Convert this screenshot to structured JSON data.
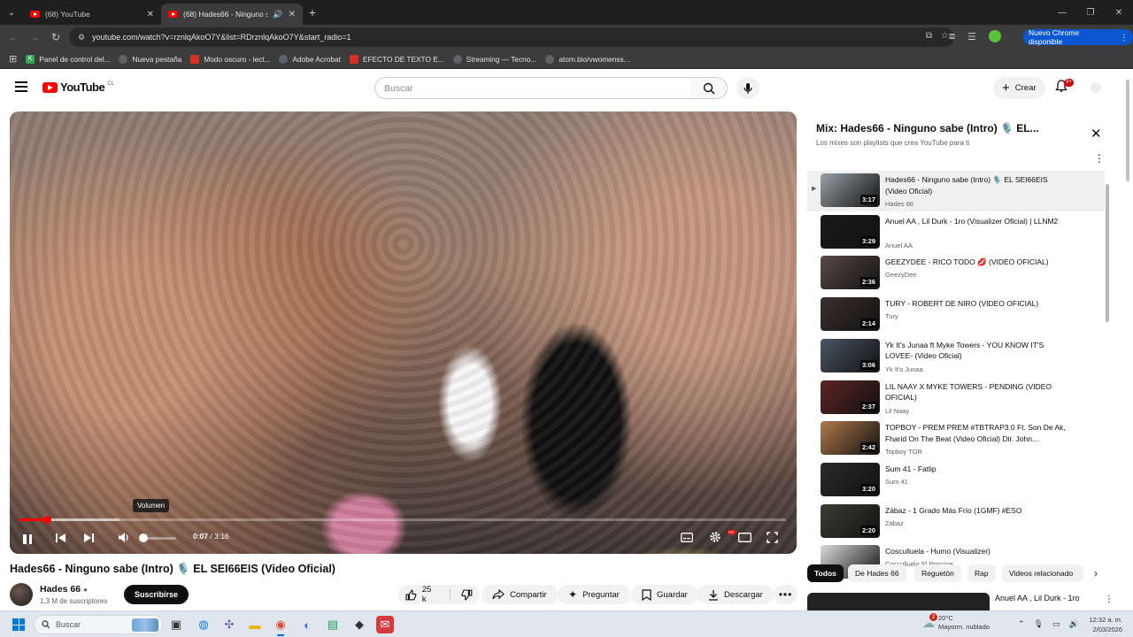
{
  "browser": {
    "tabs": [
      {
        "title": "(68) YouTube"
      },
      {
        "title": "(68) Hades66 - Ninguno sabe"
      }
    ],
    "url": "youtube.com/watch?v=rznlqAkoO7Y&list=RDrznlqAkoO7Y&start_radio=1",
    "update_button": "Nuevo Chrome disponible",
    "bookmarks": [
      {
        "label": "Panel de control del...",
        "color": "#34a853"
      },
      {
        "label": "Nueva pestaña",
        "color": "#5f6368"
      },
      {
        "label": "Modo oscuro - lect...",
        "color": "#d93025"
      },
      {
        "label": "Adobe Acrobat",
        "color": "#5f6368"
      },
      {
        "label": "EFECTO DE TEXTO E...",
        "color": "#d93025"
      },
      {
        "label": "Streaming — Tecno...",
        "color": "#5f6368"
      },
      {
        "label": "atom.bio/vwomenss...",
        "color": "#5f6368"
      }
    ]
  },
  "youtube": {
    "logo_text": "YouTube",
    "country": "CL",
    "search_placeholder": "Buscar",
    "create_label": "Crear",
    "notifications_badge": "9+"
  },
  "player": {
    "volume_tooltip": "Volumen",
    "time_current": "0:07",
    "time_total": "3:16",
    "progress_fraction": 0.036,
    "buffered_fraction": 0.13,
    "volume_fraction": 0.2
  },
  "video": {
    "title": "Hades66 - Ninguno sabe (Intro) 🎙️ EL SEI66EIS (Video Oficial)",
    "channel": "Hades 66",
    "subscribers": "1,3 M de suscriptores",
    "subscribe_label": "Suscribirse",
    "likes": "25 k",
    "share_label": "Compartir",
    "ask_label": "Preguntar",
    "save_label": "Guardar",
    "download_label": "Descargar"
  },
  "playlist": {
    "title": "Mix: Hades66 - Ninguno sabe (Intro) 🎙️ EL...",
    "subtitle": "Los mixes son playlists que crea YouTube para ti",
    "items": [
      {
        "title": "Hades66 - Ninguno sabe (Intro) 🎙️ EL SEI66EIS (Video Oficial)",
        "channel": "Hades 66",
        "duration": "3:17",
        "thumb": "#9aa1a6"
      },
      {
        "title": "Anuel AA , Lil Durk - 1ro (Visualizer Oficial) | LLNM2",
        "channel": "Anuel AA",
        "duration": "3:29",
        "thumb": "#1a1a1a"
      },
      {
        "title": "GEEZYDEE - RICO TODO 💋 (VIDEO OFICIAL)",
        "channel": "GeezyDee",
        "duration": "2:36",
        "thumb": "#5a4a48"
      },
      {
        "title": "TURY - ROBERT DE NIRO (VIDEO OFICIAL)",
        "channel": "Tury",
        "duration": "2:14",
        "thumb": "#3b3030"
      },
      {
        "title": "Yk It's Junaa ft Myke Towers - YOU KNOW IT'S LOVEE- (Video Oficial)",
        "channel": "Yk It's Junaa",
        "duration": "3:06",
        "thumb": "#4a5666"
      },
      {
        "title": "LIL NAAY X MYKE TOWERS - PENDING (VIDEO OFICIAL)",
        "channel": "Lil Naay",
        "duration": "2:37",
        "thumb": "#5e2424"
      },
      {
        "title": "TOPBOY - PREM PREM #TBTRAP3.0 Ft. Son De Ak, Fharid On The Beat (Video Oficial) Dir. John...",
        "channel": "Topboy TGR",
        "duration": "2:42",
        "thumb": "#b07a4a"
      },
      {
        "title": "Sum 41 - Fatlip",
        "channel": "Sum 41",
        "duration": "3:20",
        "thumb": "#2a2a2a"
      },
      {
        "title": "Zábaz - 1 Grado Más Frío (1GMF) #ESO",
        "channel": "Zábaz",
        "duration": "2:20",
        "thumb": "#3d3d35"
      },
      {
        "title": "Cosculluela - Humo (Visualizer)",
        "channel": "Cosculluela El Principe",
        "duration": "",
        "thumb": "#d9d9d9"
      }
    ]
  },
  "chips": [
    "Todos",
    "De Hades 66",
    "Reguetón",
    "Rap",
    "Videos relacionado"
  ],
  "recommendation": {
    "title": "Anuel AA , Lil Durk - 1ro"
  },
  "taskbar": {
    "search_placeholder": "Buscar",
    "weather_temp": "20°C",
    "weather_desc": "Mayorm. nublado",
    "weather_badge": "2",
    "time": "12:32 a. m.",
    "date": "2/03/2026"
  }
}
